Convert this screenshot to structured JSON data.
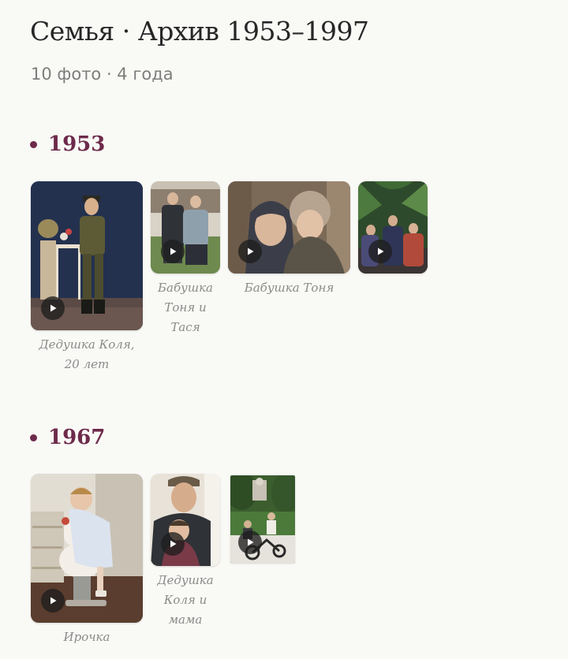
{
  "header": {
    "title": "Семья · Архив 1953–1997",
    "subtitle": "10 фото · 4 года"
  },
  "sections": [
    {
      "year": "1953",
      "photos": [
        {
          "caption": "Дедушка Коля, 20 лет"
        },
        {
          "caption": "Бабушка Тоня и Тася"
        },
        {
          "caption": "Бабушка Тоня"
        },
        {
          "caption": ""
        }
      ]
    },
    {
      "year": "1967",
      "photos": [
        {
          "caption": "Ирочка"
        },
        {
          "caption": "Дедушка Коля и мама"
        },
        {
          "caption": ""
        }
      ]
    }
  ],
  "icons": {
    "play": "play-icon",
    "bullet": "bullet-dot"
  },
  "colors": {
    "background": "#f9f9f6",
    "accent": "#6d2a4a",
    "title": "#262626",
    "subtitle": "#7d7d7d",
    "caption": "#8a8a8a"
  }
}
